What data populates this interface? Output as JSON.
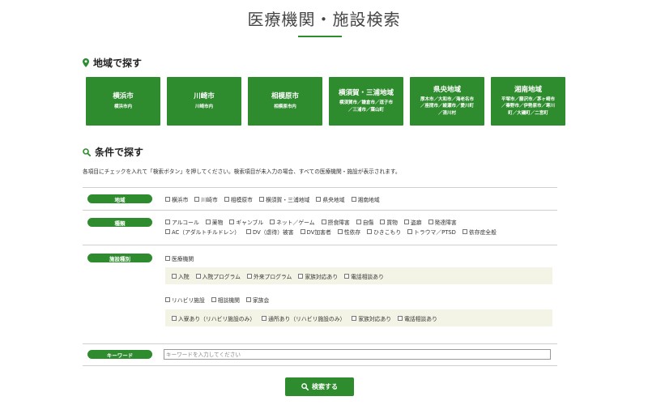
{
  "page": {
    "title": "医療機関・施設検索"
  },
  "area_section": {
    "heading": "地域で探す",
    "tiles": [
      {
        "name": "横浜市",
        "sub": [
          "横浜市内"
        ]
      },
      {
        "name": "川崎市",
        "sub": [
          "川崎市内"
        ]
      },
      {
        "name": "相模原市",
        "sub": [
          "相模原市内"
        ]
      },
      {
        "name": "横須賀・三浦地域",
        "sub": [
          "横須賀市／鎌倉市／逗子市",
          "／三浦市／葉山町"
        ]
      },
      {
        "name": "県央地域",
        "sub": [
          "厚木市／大和市／海老名市",
          "／座間市／綾瀬市／愛川町",
          "／清川村"
        ]
      },
      {
        "name": "湘南地域",
        "sub": [
          "平塚市／藤沢市／茅ヶ崎市",
          "／秦野市／伊勢原市／寒川",
          "町／大磯町／二宮町"
        ]
      }
    ]
  },
  "condition_section": {
    "heading": "条件で探す",
    "description": "各項目にチェックを入れて「検索ボタン」を押してください。検索項目が未入力の場合、すべての医療機関・施設が表示されます。"
  },
  "filters": {
    "area": {
      "label": "地域",
      "options": [
        "横浜市",
        "川崎市",
        "相模原市",
        "横須賀・三浦地域",
        "県央地域",
        "湘南地域"
      ]
    },
    "type": {
      "label": "種類",
      "options_line1": [
        "アルコール",
        "薬物",
        "ギャンブル",
        "ネット／ゲーム",
        "摂食障害",
        "自傷",
        "買物",
        "盗癖",
        "発達障害"
      ],
      "options_line2": [
        "AC（アダルトチルドレン）",
        "DV（虐待）被害",
        "DV加害者",
        "性依存",
        "ひきこもり",
        "トラウマ／PTSD",
        "依存症全般"
      ]
    },
    "facility": {
      "label": "施設種別",
      "medical": "医療機関",
      "medical_sub": [
        "入院",
        "入院プログラム",
        "外来プログラム",
        "家族対応あり",
        "電話相談あり"
      ],
      "rehab_line": [
        "リハビリ施設",
        "相談機関",
        "家族会"
      ],
      "rehab_sub": [
        "入寮あり（リハビリ施設のみ）",
        "通所あり（リハビリ施設のみ）",
        "家族対応あり",
        "電話相談あり"
      ]
    },
    "keyword": {
      "label": "キーワード",
      "placeholder": "キーワードを入力してください",
      "value": ""
    }
  },
  "search_button": {
    "label": "検索する"
  },
  "colors": {
    "brand_green": "#2e8b2e",
    "panel_bg": "#f4f4e6"
  },
  "icons": {
    "area": "map-pin-icon",
    "condition": "search-icon"
  }
}
